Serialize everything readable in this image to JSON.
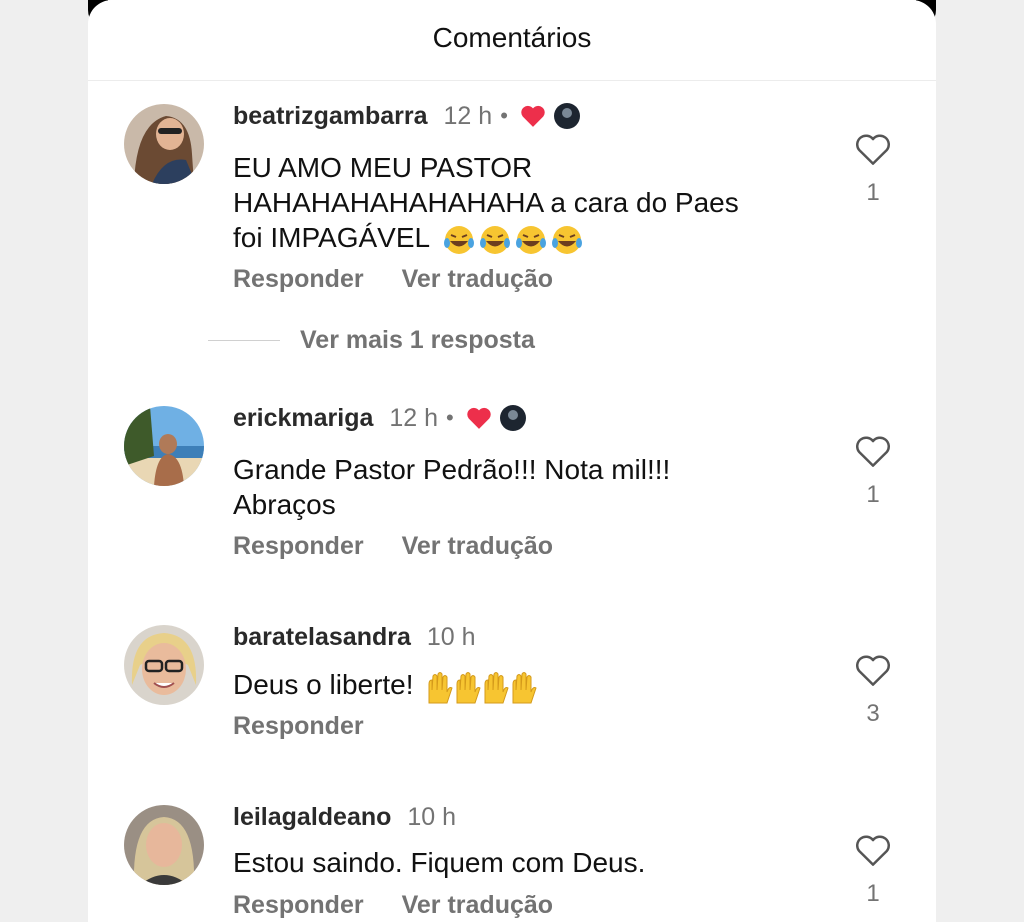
{
  "header": {
    "title": "Comentários"
  },
  "comments": [
    {
      "username": "beatrizgambarra",
      "time": "12 h",
      "separator": "•",
      "text_lines": [
        "EU AMO MEU PASTOR",
        "HAHAHAHAHAHAHAHA a cara do Paes",
        "foi IMPAGÁVEL"
      ],
      "reply_label": "Responder",
      "translate_label": "Ver tradução",
      "like_count": "1",
      "liked_by_author": true
    },
    {
      "username": "erickmariga",
      "time": "12 h",
      "separator": "•",
      "text_lines": [
        "Grande Pastor Pedrão!!! Nota mil!!!",
        "Abraços"
      ],
      "reply_label": "Responder",
      "translate_label": "Ver tradução",
      "like_count": "1",
      "liked_by_author": true
    },
    {
      "username": "baratelasandra",
      "time": "10 h",
      "text_lines": [
        "Deus o liberte!"
      ],
      "reply_label": "Responder",
      "like_count": "3"
    },
    {
      "username": "leilagaldeano",
      "time": "10 h",
      "text_lines": [
        "Estou saindo. Fiquem com Deus."
      ],
      "reply_label": "Responder",
      "translate_label": "Ver tradução",
      "like_count": "1"
    }
  ],
  "more_replies": {
    "label": "Ver mais 1 resposta"
  },
  "icons": {
    "like": "heart-outline-icon",
    "author_like": "red-heart-icon",
    "laugh_emoji": "face-with-tears-of-joy",
    "praise_emoji": "raising-hands"
  },
  "colors": {
    "author_heart": "#ed2f4b",
    "muted_text": "#737373"
  }
}
